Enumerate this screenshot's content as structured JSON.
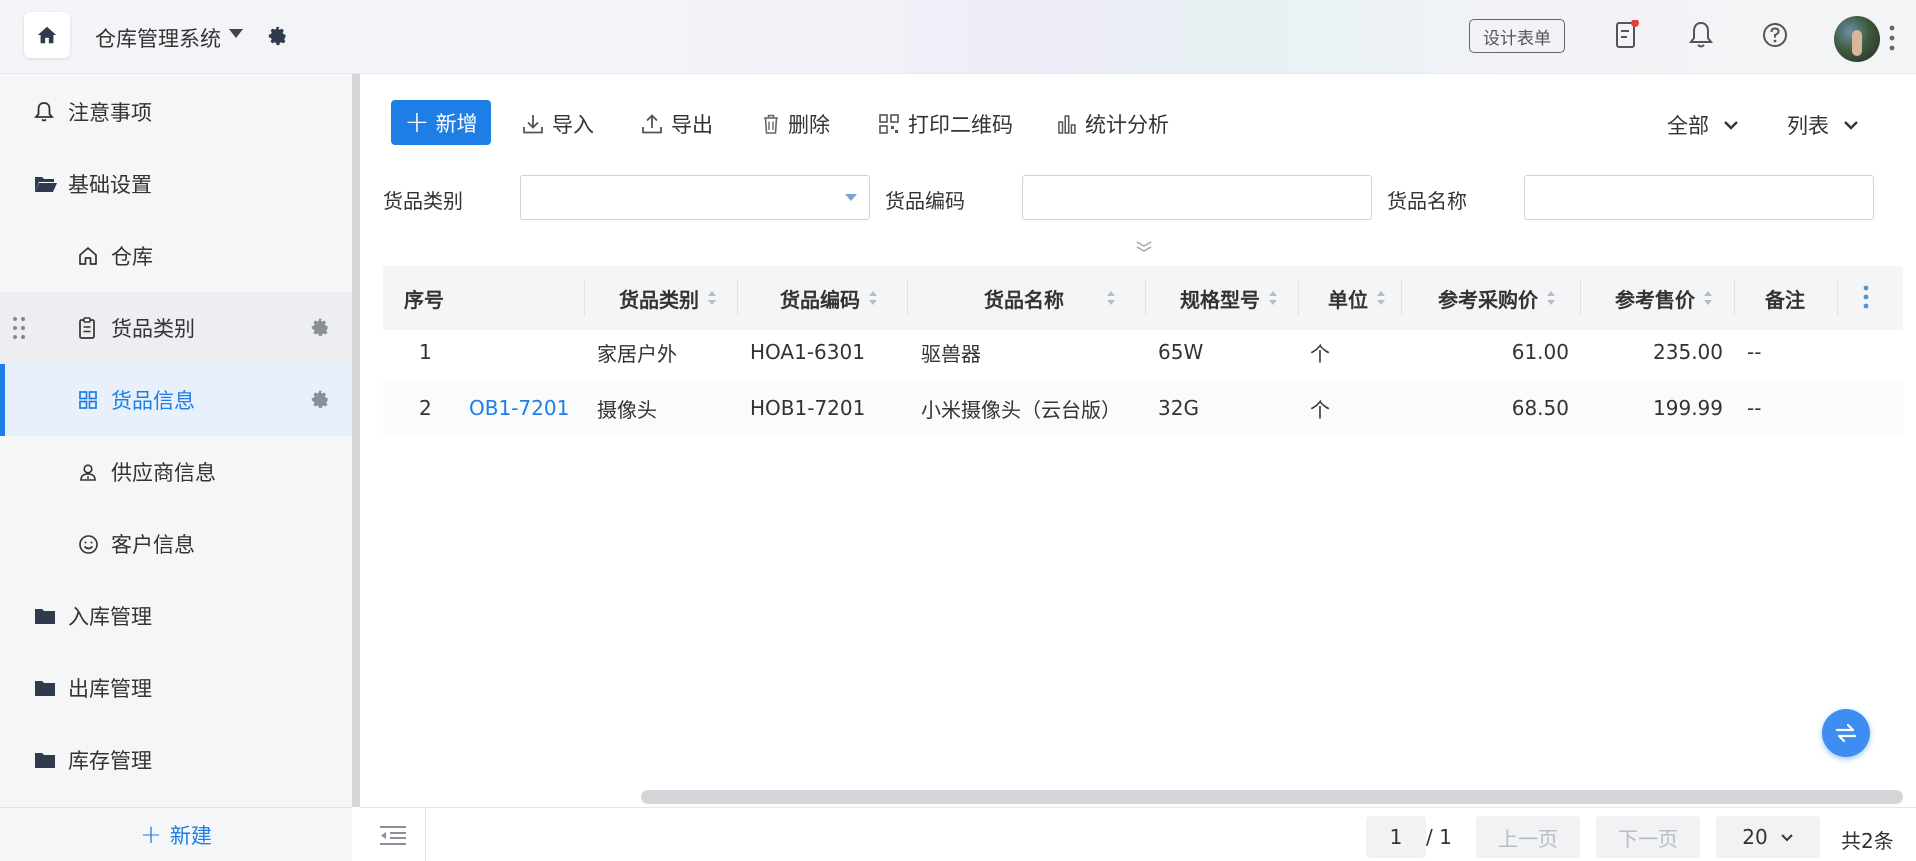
{
  "header": {
    "app_title": "仓库管理系统",
    "design_form_label": "设计表单"
  },
  "sidebar": {
    "items": [
      {
        "label": "注意事项",
        "icon": "bell-icon"
      },
      {
        "label": "基础设置",
        "icon": "folder-open-icon"
      },
      {
        "label": "仓库",
        "icon": "home-outline-icon"
      },
      {
        "label": "货品类别",
        "icon": "clipboard-icon"
      },
      {
        "label": "货品信息",
        "icon": "grid-icon"
      },
      {
        "label": "供应商信息",
        "icon": "user-badge-icon"
      },
      {
        "label": "客户信息",
        "icon": "smile-icon"
      },
      {
        "label": "入库管理",
        "icon": "folder-icon"
      },
      {
        "label": "出库管理",
        "icon": "folder-icon"
      },
      {
        "label": "库存管理",
        "icon": "folder-icon"
      }
    ],
    "new_label": "新建"
  },
  "toolbar": {
    "add_label": "新增",
    "import_label": "导入",
    "export_label": "导出",
    "delete_label": "删除",
    "print_qr_label": "打印二维码",
    "stats_label": "统计分析",
    "scope_label": "全部",
    "view_label": "列表"
  },
  "filters": {
    "category_label": "货品类别",
    "code_label": "货品编码",
    "name_label": "货品名称",
    "category_value": "",
    "code_value": "",
    "name_value": ""
  },
  "table": {
    "columns": [
      "序号",
      "货品类别",
      "货品编码",
      "货品名称",
      "规格型号",
      "单位",
      "参考采购价",
      "参考售价",
      "备注"
    ],
    "rows": [
      {
        "seq": "1",
        "extra": "",
        "category": "家居户外",
        "code": "HOA1-6301",
        "name": "驱兽器",
        "spec": "65W",
        "unit": "个",
        "purchase": "61.00",
        "sale": "235.00",
        "remark": "--"
      },
      {
        "seq": "2",
        "extra": "OB1-7201",
        "category": "摄像头",
        "code": "HOB1-7201",
        "name": "小米摄像头（云台版）",
        "spec": "32G",
        "unit": "个",
        "purchase": "68.50",
        "sale": "199.99",
        "remark": "--"
      }
    ]
  },
  "pager": {
    "current_page": "1",
    "total_pages": "/ 1",
    "prev_label": "上一页",
    "next_label": "下一页",
    "page_size": "20",
    "count_label": "共2条"
  },
  "colors": {
    "accent": "#1e7ee6",
    "notification_dot": "#e5413a"
  }
}
